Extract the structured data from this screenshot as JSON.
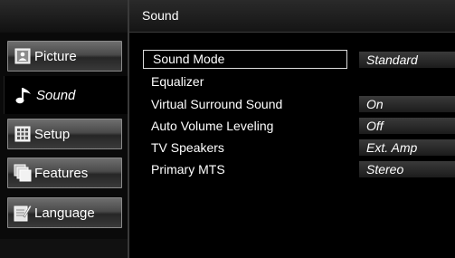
{
  "header": {
    "title": "Sound"
  },
  "sidebar": {
    "items": [
      {
        "label": "Picture",
        "icon": "picture-icon",
        "active": false
      },
      {
        "label": "Sound",
        "icon": "music-note-icon",
        "active": true
      },
      {
        "label": "Setup",
        "icon": "setup-grid-icon",
        "active": false
      },
      {
        "label": "Features",
        "icon": "features-cards-icon",
        "active": false
      },
      {
        "label": "Language",
        "icon": "language-pencil-icon",
        "active": false
      }
    ]
  },
  "menu": {
    "rows": [
      {
        "label": "Sound Mode",
        "value": "Standard",
        "selected": true
      },
      {
        "label": "Equalizer",
        "value": null,
        "selected": false
      },
      {
        "label": "Virtual Surround Sound",
        "value": "On",
        "selected": false
      },
      {
        "label": "Auto Volume Leveling",
        "value": "Off",
        "selected": false
      },
      {
        "label": "TV Speakers",
        "value": "Ext. Amp",
        "selected": false
      },
      {
        "label": "Primary MTS",
        "value": "Stereo",
        "selected": false
      }
    ]
  },
  "colors": {
    "background": "#000000",
    "text": "#ffffff",
    "selection_border": "#dddddd",
    "tab_gray": "#5a5a5a"
  }
}
